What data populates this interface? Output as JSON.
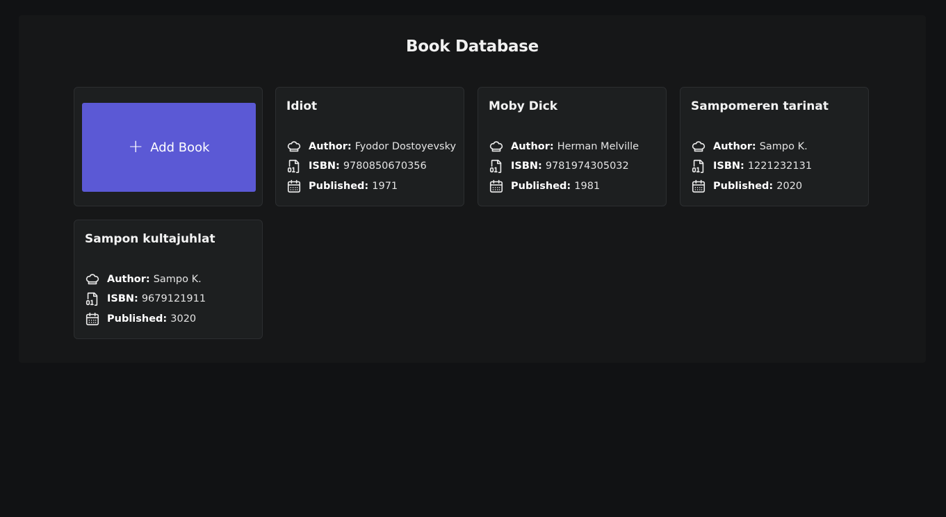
{
  "title": "Book Database",
  "add_button": {
    "label": "Add Book",
    "icon": "plus-icon"
  },
  "labels": {
    "author": "Author:",
    "isbn": "ISBN:",
    "published": "Published:"
  },
  "colors": {
    "background": "#111214",
    "panel": "#161718",
    "card": "#1d1f20",
    "accent": "#5b59d5"
  },
  "books": [
    {
      "title": "Idiot",
      "author": "Fyodor Dostoyevsky",
      "isbn": "9780850670356",
      "published": "1971"
    },
    {
      "title": "Moby Dick",
      "author": "Herman Melville",
      "isbn": "9781974305032",
      "published": "1981"
    },
    {
      "title": "Sampomeren tarinat",
      "author": "Sampo K.",
      "isbn": "1221232131",
      "published": "2020"
    },
    {
      "title": "Sampon kultajuhlat",
      "author": "Sampo K.",
      "isbn": "9679121911",
      "published": "3020"
    }
  ]
}
